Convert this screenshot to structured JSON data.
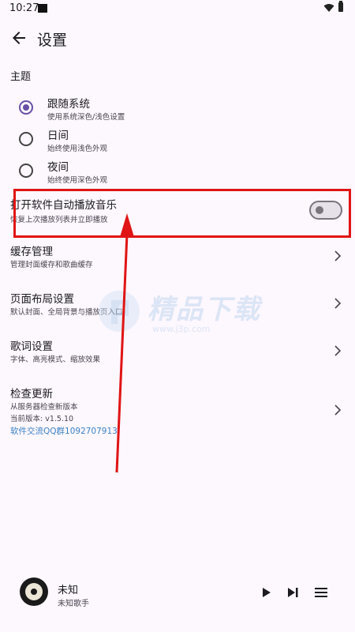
{
  "status_bar": {
    "time": "10:27"
  },
  "app_bar": {
    "title": "设置"
  },
  "theme": {
    "label": "主题",
    "options": [
      {
        "title": "跟随系统",
        "subtitle": "使用系统深色/浅色设置",
        "selected": true
      },
      {
        "title": "日间",
        "subtitle": "始终使用浅色外观",
        "selected": false
      },
      {
        "title": "夜间",
        "subtitle": "始终使用深色外观",
        "selected": false
      }
    ]
  },
  "autoplay": {
    "title": "打开软件自动播放音乐",
    "subtitle": "恢复上次播放列表并立即播放",
    "enabled": false
  },
  "items": [
    {
      "title": "缓存管理",
      "subtitle": "管理封面缓存和歌曲缓存"
    },
    {
      "title": "页面布局设置",
      "subtitle": "默认封面、全局背景与播放页入口"
    },
    {
      "title": "歌词设置",
      "subtitle": "字体、高亮模式、缩放效果"
    }
  ],
  "update": {
    "title": "检查更新",
    "subtitle": "从服务器检查新版本",
    "version": "当前版本: v1.5.10",
    "group_link": "软件交流QQ群1092707913"
  },
  "watermark": {
    "brand": "精品下载",
    "url": "www.j3p.com"
  },
  "player": {
    "title": "未知",
    "artist": "未知歌手"
  },
  "colors": {
    "accent": "#6750a4",
    "highlight": "#e01414",
    "link": "#3b82c4"
  }
}
